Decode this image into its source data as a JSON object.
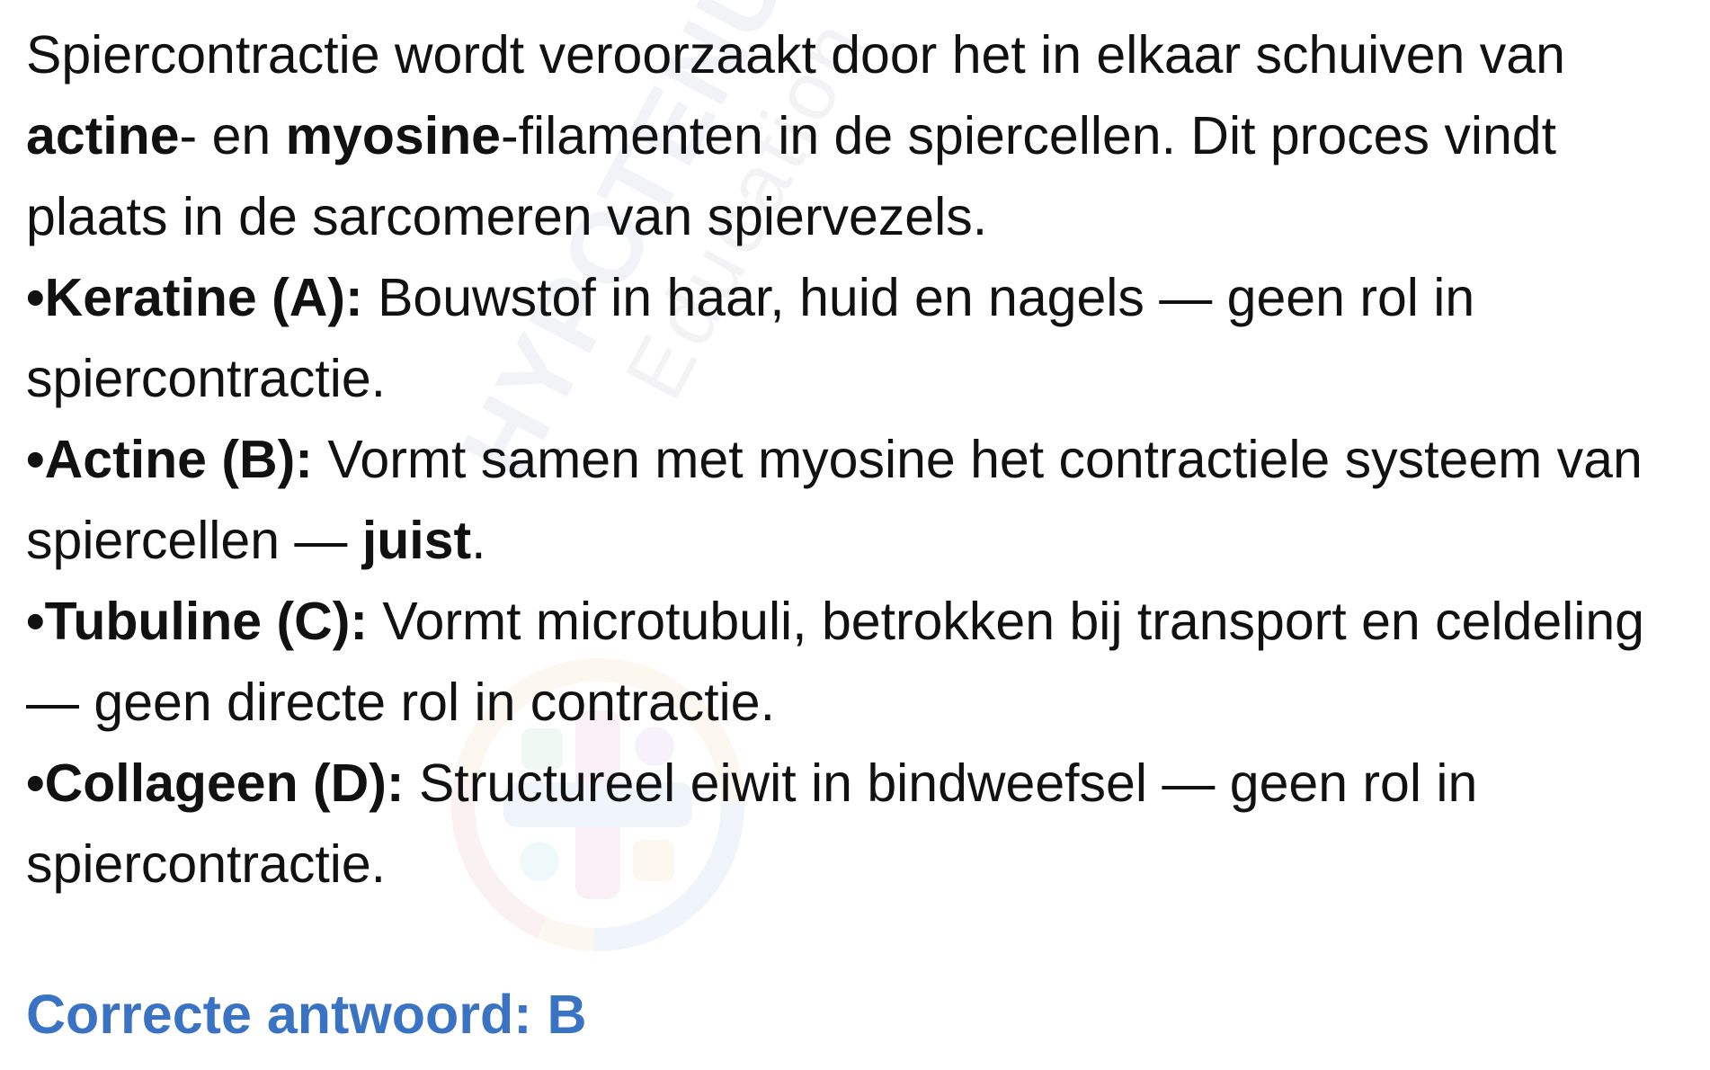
{
  "intro": {
    "part1": "Spiercontractie wordt veroorzaakt door het in elkaar schuiven van ",
    "actine": "actine",
    "part2": "- en ",
    "myosine": "myosine",
    "part3": "-filamenten in de spiercellen. Dit proces vindt plaats in de sarcomeren van spiervezels."
  },
  "options": [
    {
      "bullet": "•",
      "label": "Keratine (A):",
      "text": " Bouwstof in haar, huid en nagels — geen rol in spiercontractie."
    },
    {
      "bullet": "•",
      "label": "Actine (B):",
      "text": " Vormt samen met myosine het contractiele systeem van spiercellen — ",
      "emphasis": "juist",
      "after": "."
    },
    {
      "bullet": "•",
      "label": "Tubuline (C):",
      "text": " Vormt microtubuli, betrokken bij transport en celdeling — geen directe rol in contractie."
    },
    {
      "bullet": "•",
      "label": "Collageen (D):",
      "text": " Structureel eiwit in bindweefsel — geen rol in spiercontractie."
    }
  ],
  "answer": "Correcte antwoord: B",
  "watermark": {
    "main": "HYPOTENUSE",
    "sub": "Education Center"
  },
  "colors": {
    "text": "#111111",
    "answer": "#3a73c4",
    "background": "#ffffff"
  }
}
